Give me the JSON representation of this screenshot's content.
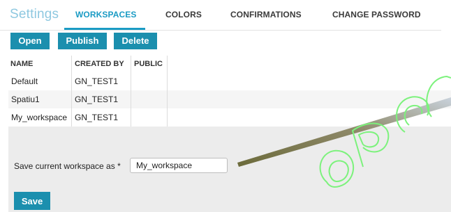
{
  "header": {
    "app_title": "Settings",
    "tabs": [
      {
        "label": "WORKSPACES",
        "active": true
      },
      {
        "label": "COLORS",
        "active": false
      },
      {
        "label": "CONFIRMATIONS",
        "active": false
      },
      {
        "label": "CHANGE PASSWORD",
        "active": false
      }
    ]
  },
  "toolbar": {
    "open_label": "Open",
    "publish_label": "Publish",
    "delete_label": "Delete"
  },
  "table": {
    "columns": [
      "NAME",
      "CREATED BY",
      "PUBLIC"
    ],
    "rows": [
      {
        "name": "Default",
        "created_by": "GN_TEST1",
        "public": ""
      },
      {
        "name": "Spatiu1",
        "created_by": "GN_TEST1",
        "public": ""
      },
      {
        "name": "My_workspace",
        "created_by": "GN_TEST1",
        "public": ""
      }
    ]
  },
  "save_form": {
    "label": "Save current workspace as *",
    "input_value": "My_workspace",
    "save_label": "Save"
  },
  "colors": {
    "accent": "#1a9bc4",
    "button": "#1b8fae",
    "title": "#8ec8e0"
  }
}
